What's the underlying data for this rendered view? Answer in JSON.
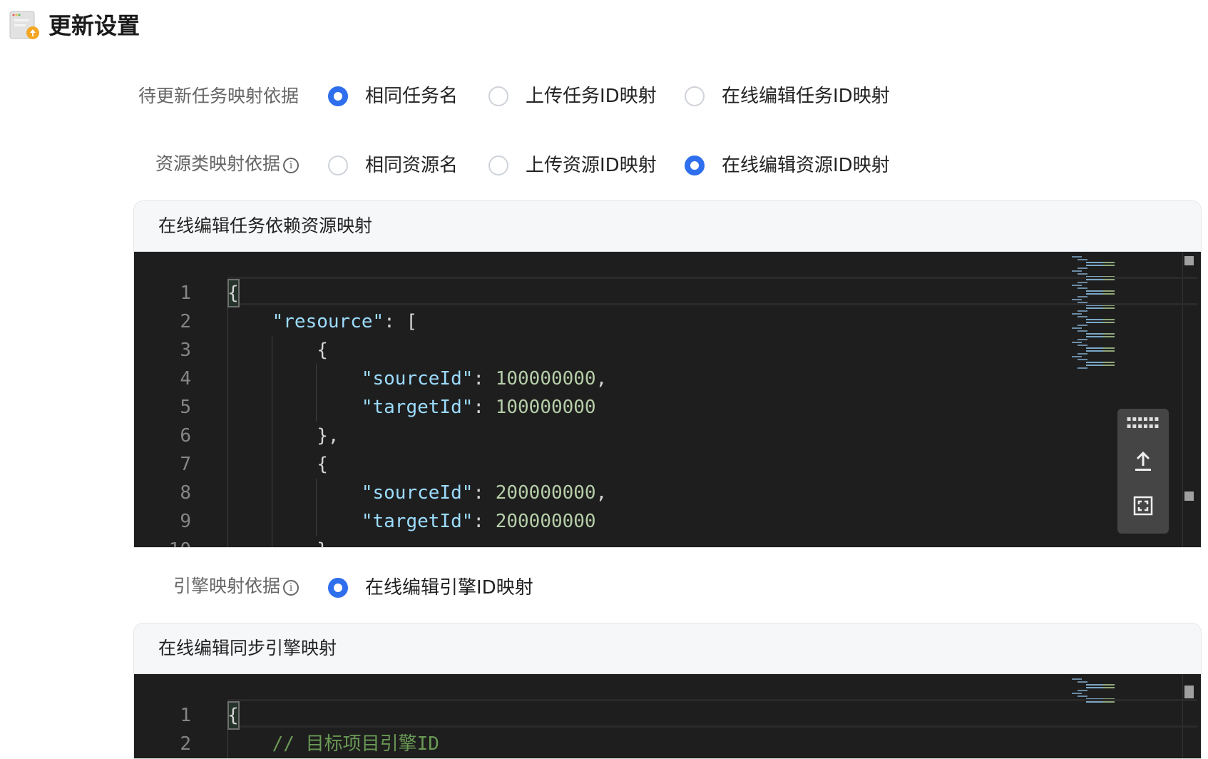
{
  "header": {
    "title": "更新设置",
    "icon": "update-settings-icon"
  },
  "task_mapping": {
    "label": "待更新任务映射依据",
    "options": [
      {
        "label": "相同任务名",
        "selected": true
      },
      {
        "label": "上传任务ID映射",
        "selected": false
      },
      {
        "label": "在线编辑任务ID映射",
        "selected": false
      }
    ]
  },
  "resource_mapping": {
    "label": "资源类映射依据",
    "info_icon": "i",
    "options": [
      {
        "label": "相同资源名",
        "selected": false
      },
      {
        "label": "上传资源ID映射",
        "selected": false
      },
      {
        "label": "在线编辑资源ID映射",
        "selected": true
      }
    ],
    "panel_title": "在线编辑任务依赖资源映射",
    "code": [
      [
        {
          "t": "{",
          "c": "punc"
        }
      ],
      [
        {
          "t": "    ",
          "c": "punc"
        },
        {
          "t": "\"resource\"",
          "c": "key"
        },
        {
          "t": ": [",
          "c": "punc"
        }
      ],
      [
        {
          "t": "        {",
          "c": "punc"
        }
      ],
      [
        {
          "t": "            ",
          "c": "punc"
        },
        {
          "t": "\"sourceId\"",
          "c": "key"
        },
        {
          "t": ": ",
          "c": "punc"
        },
        {
          "t": "100000000",
          "c": "num"
        },
        {
          "t": ",",
          "c": "punc"
        }
      ],
      [
        {
          "t": "            ",
          "c": "punc"
        },
        {
          "t": "\"targetId\"",
          "c": "key"
        },
        {
          "t": ": ",
          "c": "punc"
        },
        {
          "t": "100000000",
          "c": "num"
        }
      ],
      [
        {
          "t": "        },",
          "c": "punc"
        }
      ],
      [
        {
          "t": "        {",
          "c": "punc"
        }
      ],
      [
        {
          "t": "            ",
          "c": "punc"
        },
        {
          "t": "\"sourceId\"",
          "c": "key"
        },
        {
          "t": ": ",
          "c": "punc"
        },
        {
          "t": "200000000",
          "c": "num"
        },
        {
          "t": ",",
          "c": "punc"
        }
      ],
      [
        {
          "t": "            ",
          "c": "punc"
        },
        {
          "t": "\"targetId\"",
          "c": "key"
        },
        {
          "t": ": ",
          "c": "punc"
        },
        {
          "t": "200000000",
          "c": "num"
        }
      ],
      [
        {
          "t": "        }",
          "c": "punc"
        }
      ]
    ]
  },
  "engine_mapping": {
    "label": "引擎映射依据",
    "info_icon": "i",
    "options": [
      {
        "label": "在线编辑引擎ID映射",
        "selected": true
      }
    ],
    "panel_title": "在线编辑同步引擎映射",
    "code": [
      [
        {
          "t": "{",
          "c": "punc"
        }
      ],
      [
        {
          "t": "    ",
          "c": "punc"
        },
        {
          "t": "// 目标项目引擎ID",
          "c": "comment"
        }
      ]
    ]
  },
  "editor_tools": [
    "drag-handle-icon",
    "upload-icon",
    "fullscreen-icon"
  ],
  "colors": {
    "accent": "#2f6fed",
    "editor_bg": "#1e1e1e",
    "key": "#9cdcfe",
    "number": "#b5cea8",
    "comment": "#6a9955"
  }
}
